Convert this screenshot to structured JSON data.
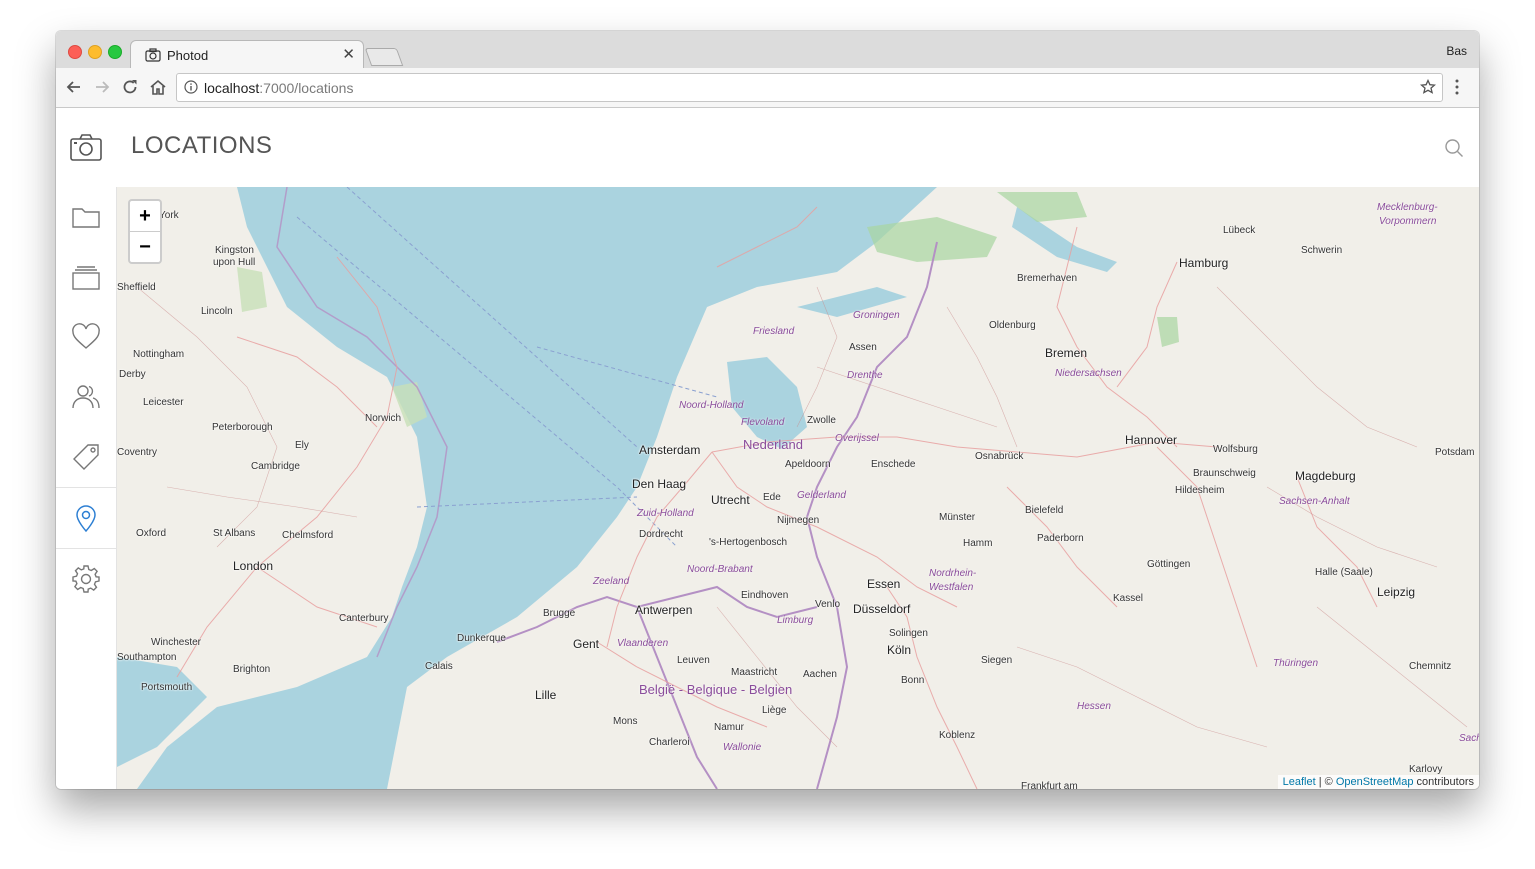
{
  "browser": {
    "tab_title": "Photod",
    "profile_name": "Bas",
    "url_host": "localhost",
    "url_port_path": ":7000/locations"
  },
  "app": {
    "page_title": "LOCATIONS"
  },
  "sidebar": {
    "items": [
      {
        "name": "folders",
        "icon": "folder-icon"
      },
      {
        "name": "albums",
        "icon": "stack-icon"
      },
      {
        "name": "favorites",
        "icon": "heart-icon"
      },
      {
        "name": "people",
        "icon": "people-icon"
      },
      {
        "name": "tags",
        "icon": "tag-icon"
      },
      {
        "name": "locations",
        "icon": "map-pin-icon",
        "active": true
      },
      {
        "name": "settings",
        "icon": "gear-icon"
      }
    ]
  },
  "map": {
    "zoom_in_label": "+",
    "zoom_out_label": "−",
    "attribution": {
      "leaflet": "Leaflet",
      "separator": " | © ",
      "osm": "OpenStreetMap",
      "suffix": " contributors"
    },
    "labels": {
      "york": "York",
      "kingston": "Kingston",
      "kingston2": "upon Hull",
      "sheffield": "Sheffield",
      "lincoln": "Lincoln",
      "nottingham": "Nottingham",
      "derby": "Derby",
      "leicester": "Leicester",
      "peterborough": "Peterborough",
      "norwich": "Norwich",
      "ely": "Ely",
      "coventry": "Coventry",
      "cambridge": "Cambridge",
      "oxford": "Oxford",
      "stalbans": "St Albans",
      "chelmsford": "Chelmsford",
      "london": "London",
      "canterbury": "Canterbury",
      "winchester": "Winchester",
      "southampton": "Southampton",
      "brighton": "Brighton",
      "portsmouth": "Portsmouth",
      "dunkerque": "Dunkerque",
      "calais": "Calais",
      "lille": "Lille",
      "brugge": "Brugge",
      "gent": "Gent",
      "antwerpen": "Antwerpen",
      "leuven": "Leuven",
      "mons": "Mons",
      "charleroi": "Charleroi",
      "namur": "Namur",
      "liege": "Liège",
      "maastricht": "Maastricht",
      "aachen": "Aachen",
      "amsterdam": "Amsterdam",
      "denhaag": "Den Haag",
      "utrecht": "Utrecht",
      "ede": "Ede",
      "dordrecht": "Dordrecht",
      "shertogenbosch": "'s-Hertogenbosch",
      "eindhoven": "Eindhoven",
      "venlo": "Venlo",
      "nijmegen": "Nijmegen",
      "apeldoorn": "Apeldoorn",
      "zwolle": "Zwolle",
      "enschede": "Enschede",
      "assen": "Assen",
      "groningen": "Groningen",
      "oldenburg": "Oldenburg",
      "bremen": "Bremen",
      "bremerhaven": "Bremerhaven",
      "hamburg": "Hamburg",
      "lubeck": "Lübeck",
      "schwerin": "Schwerin",
      "hannover": "Hannover",
      "wolfsburg": "Wolfsburg",
      "braunschweig": "Braunschweig",
      "magdeburg": "Magdeburg",
      "potsdam": "Potsdam",
      "hildesheim": "Hildesheim",
      "osnabruck": "Osnabrück",
      "bielefeld": "Bielefeld",
      "munster": "Münster",
      "paderborn": "Paderborn",
      "hamm": "Hamm",
      "essen": "Essen",
      "dusseldorf": "Düsseldorf",
      "solingen": "Solingen",
      "koln": "Köln",
      "bonn": "Bonn",
      "siegen": "Siegen",
      "kassel": "Kassel",
      "gottingen": "Göttingen",
      "halle": "Halle (Saale)",
      "leipzig": "Leipzig",
      "chemnitz": "Chemnitz",
      "koblenz": "Koblenz",
      "frankfurt": "Frankfurt am",
      "karlovy": "Karlovy",
      "belgie": "België - Belgique - Belgien"
    },
    "regions": {
      "friesland": "Friesland",
      "groningen": "Groningen",
      "drenthe": "Drenthe",
      "noordholland": "Noord-Holland",
      "flevoland": "Flevoland",
      "nederland": "Nederland",
      "overijssel": "Overijssel",
      "gelderland": "Gelderland",
      "zuidholland": "Zuid-Holland",
      "zeeland": "Zeeland",
      "noordbrabant": "Noord-Brabant",
      "limburg": "Limburg",
      "vlaanderen": "Vlaanderen",
      "wallonie": "Wallonie",
      "niedersachsen": "Niedersachsen",
      "nrw1": "Nordrhein-",
      "nrw2": "Westfalen",
      "sachsenanhalt": "Sachsen-Anhalt",
      "thuringen": "Thüringen",
      "hessen": "Hessen",
      "meck1": "Mecklenburg-",
      "meck2": "Vorpommern",
      "sachsen": "Sachs"
    }
  }
}
